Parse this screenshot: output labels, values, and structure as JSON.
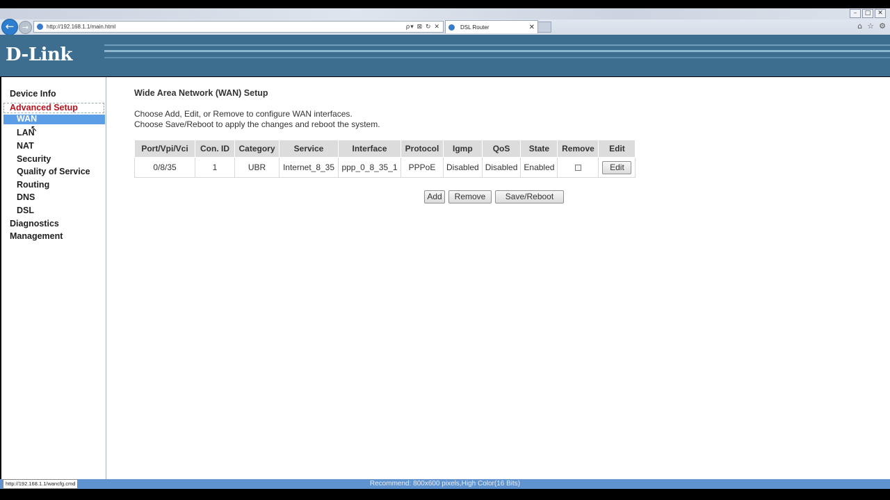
{
  "browser": {
    "url": "http://192.168.1.1/main.html",
    "tab_title": "DSL Router",
    "back_glyph": "←",
    "forward_glyph": "→",
    "addr_tools": "ρ▾ ⊠ ↻ ✕",
    "tab_close": "✕",
    "window_controls": [
      "–",
      "□",
      "✕"
    ],
    "right_icons": [
      "⌂",
      "☆",
      "⚙"
    ]
  },
  "banner": {
    "logo": "D-Link"
  },
  "sidebar": {
    "items": [
      {
        "label": "Device Info"
      },
      {
        "label": "Advanced Setup"
      },
      {
        "label": "WAN"
      },
      {
        "label": "LAN"
      },
      {
        "label": "NAT"
      },
      {
        "label": "Security"
      },
      {
        "label": "Quality of Service"
      },
      {
        "label": "Routing"
      },
      {
        "label": "DNS"
      },
      {
        "label": "DSL"
      },
      {
        "label": "Diagnostics"
      },
      {
        "label": "Management"
      }
    ]
  },
  "main": {
    "title": "Wide Area Network (WAN) Setup",
    "desc_line1": "Choose Add, Edit, or Remove to configure WAN interfaces.",
    "desc_line2": "Choose Save/Reboot to apply the changes and reboot the system.",
    "table": {
      "headers": [
        "Port/Vpi/Vci",
        "Con. ID",
        "Category",
        "Service",
        "Interface",
        "Protocol",
        "Igmp",
        "QoS",
        "State",
        "Remove",
        "Edit"
      ],
      "rows": [
        [
          "0/8/35",
          "1",
          "UBR",
          "Internet_8_35",
          "ppp_0_8_35_1",
          "PPPoE",
          "Disabled",
          "Disabled",
          "Enabled",
          "",
          "Edit"
        ]
      ]
    },
    "buttons": {
      "add": "Add",
      "remove": "Remove",
      "save_reboot": "Save/Reboot"
    }
  },
  "status_bar": {
    "url": "http://192.168.1.1/wancfg.cmd",
    "text": "Recommend: 800x600 pixels,High Color(16 Bits)"
  },
  "colors": {
    "banner": "#3d6e8f",
    "active_menu_text": "#b3131e",
    "selected_menu_bg": "#5c9ee6",
    "status_bar": "#5f93cf"
  }
}
